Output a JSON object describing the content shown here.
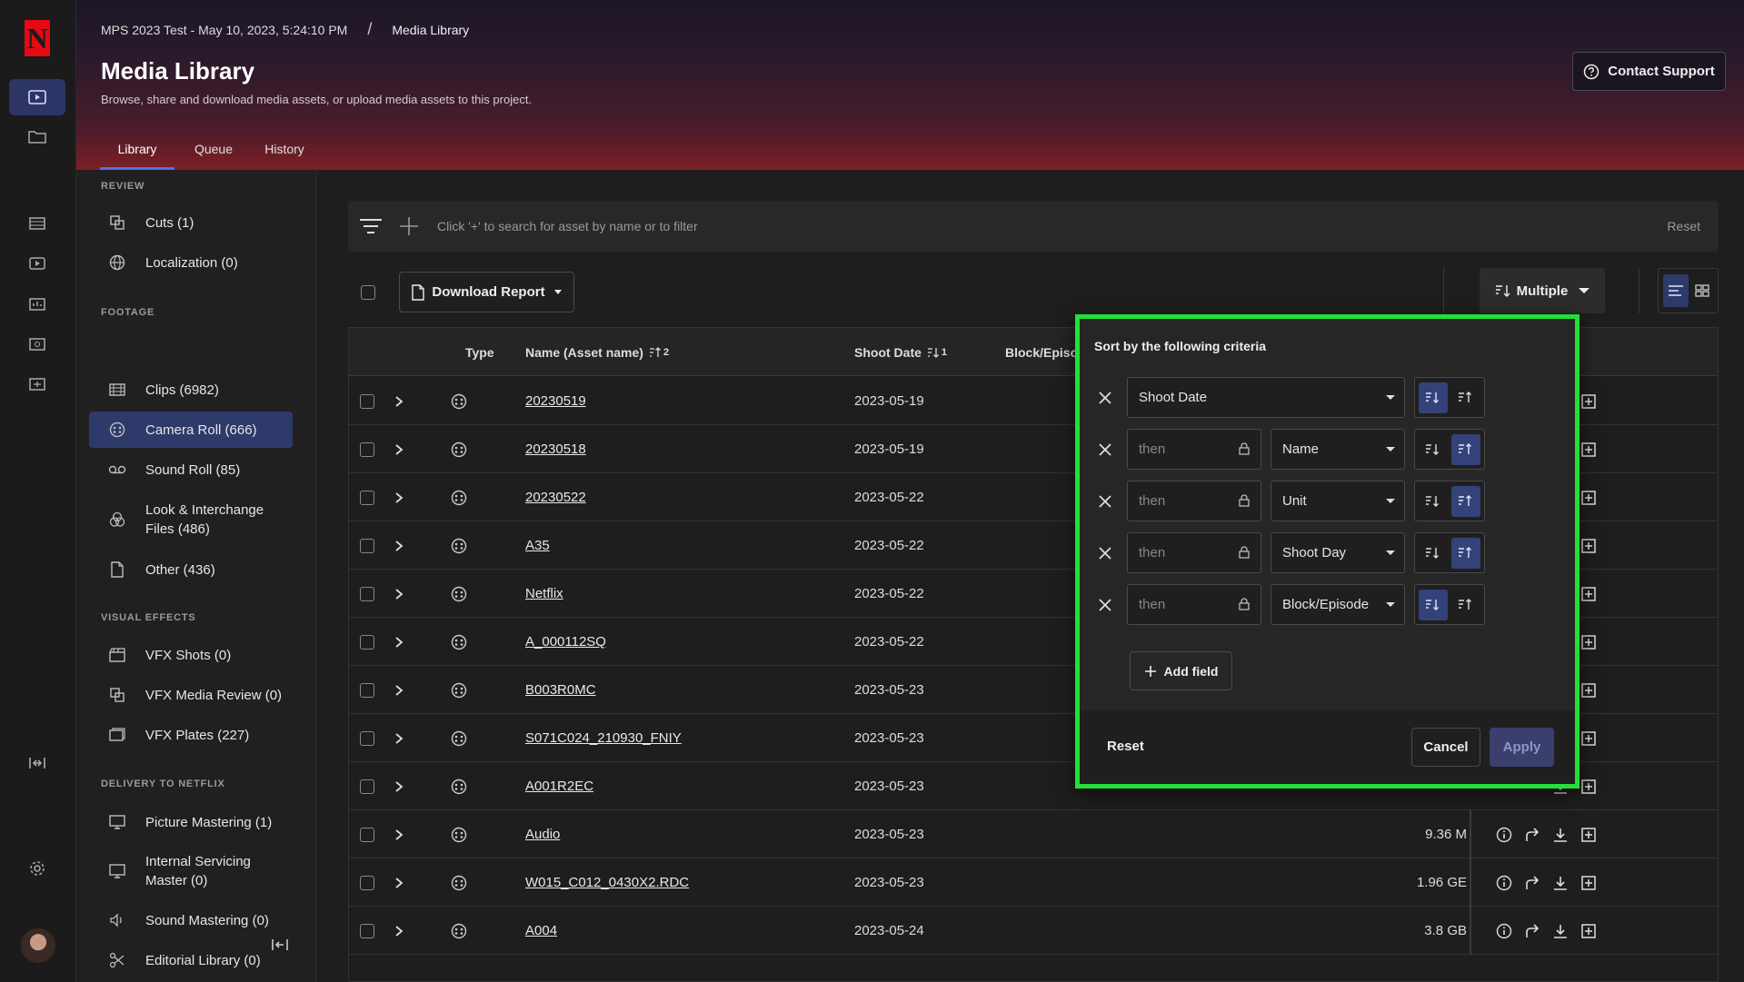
{
  "app": {
    "brand_letter": "N"
  },
  "header": {
    "breadcrumb_project": "MPS 2023 Test - May 10, 2023, 5:24:10 PM",
    "breadcrumb_sep": "/",
    "breadcrumb_current": "Media Library",
    "title": "Media Library",
    "subtitle": "Browse, share and download media assets, or upload media assets to this project.",
    "contact_support": "Contact Support",
    "tabs": [
      {
        "label": "Library",
        "active": true
      },
      {
        "label": "Queue"
      },
      {
        "label": "History"
      }
    ]
  },
  "sidebar": {
    "sections": [
      "REVIEW",
      "FOOTAGE",
      "VISUAL EFFECTS",
      "DELIVERY TO NETFLIX"
    ],
    "items": [
      {
        "label": "Cuts (1)",
        "icon": "cuts-icon"
      },
      {
        "label": "Localization (0)",
        "icon": "globe-icon"
      },
      {
        "label": "Clips (6982)",
        "icon": "film-icon"
      },
      {
        "label": "Camera Roll (666)",
        "icon": "reel-icon",
        "active": true
      },
      {
        "label": "Sound Roll (85)",
        "icon": "tape-icon"
      },
      {
        "label": "Look & Interchange Files (486)",
        "icon": "color-icon"
      },
      {
        "label": "Other (436)",
        "icon": "file-icon"
      },
      {
        "label": "VFX Shots (0)",
        "icon": "clapper-icon"
      },
      {
        "label": "VFX Media Review (0)",
        "icon": "review-icon"
      },
      {
        "label": "VFX Plates (227)",
        "icon": "plates-icon"
      },
      {
        "label": "Picture Mastering (1)",
        "icon": "monitor-icon"
      },
      {
        "label": "Internal Servicing Master (0)",
        "icon": "monitor-icon"
      },
      {
        "label": "Sound Mastering (0)",
        "icon": "speaker-icon"
      },
      {
        "label": "Editorial Library (0)",
        "icon": "scissors-icon"
      }
    ]
  },
  "search": {
    "placeholder": "Click '+' to search for asset by name or to filter",
    "reset": "Reset"
  },
  "toolbar": {
    "download_report": "Download Report",
    "sort_mode": "Multiple"
  },
  "table": {
    "columns": {
      "type": "Type",
      "name": "Name (Asset name)",
      "name_sort_rank": "2",
      "shoot_date": "Shoot Date",
      "shoot_date_sort_rank": "1",
      "block": "Block/Episo"
    },
    "rows": [
      {
        "name": "20230519",
        "date": "2023-05-19",
        "size": ""
      },
      {
        "name": "20230518",
        "date": "2023-05-19",
        "size": ""
      },
      {
        "name": "20230522",
        "date": "2023-05-22",
        "size": ""
      },
      {
        "name": "A35",
        "date": "2023-05-22",
        "size": ""
      },
      {
        "name": "Netflix",
        "date": "2023-05-22",
        "size": ""
      },
      {
        "name": "A_000112SQ",
        "date": "2023-05-22",
        "size": ""
      },
      {
        "name": "B003R0MC",
        "date": "2023-05-23",
        "size": ""
      },
      {
        "name": "S071C024_210930_FNIY",
        "date": "2023-05-23",
        "size": ""
      },
      {
        "name": "A001R2EC",
        "date": "2023-05-23",
        "size": ""
      },
      {
        "name": "Audio",
        "date": "2023-05-23",
        "size": "9.36 M"
      },
      {
        "name": "W015_C012_0430X2.RDC",
        "date": "2023-05-23",
        "size": "1.96 GE"
      },
      {
        "name": "A004",
        "date": "2023-05-24",
        "size": "3.8 GB"
      }
    ]
  },
  "sort_popover": {
    "title": "Sort by the following criteria",
    "then": "then",
    "criteria": [
      {
        "field": "Shoot Date",
        "direction": "desc"
      },
      {
        "field": "Name",
        "direction": "asc"
      },
      {
        "field": "Unit",
        "direction": "asc"
      },
      {
        "field": "Shoot Day",
        "direction": "asc"
      },
      {
        "field": "Block/Episode",
        "direction": "desc"
      }
    ],
    "add_field": "Add field",
    "reset": "Reset",
    "cancel": "Cancel",
    "apply": "Apply"
  },
  "colors": {
    "accent": "#2e3a6a",
    "highlight_border": "#22e035",
    "brand": "#e50914"
  }
}
